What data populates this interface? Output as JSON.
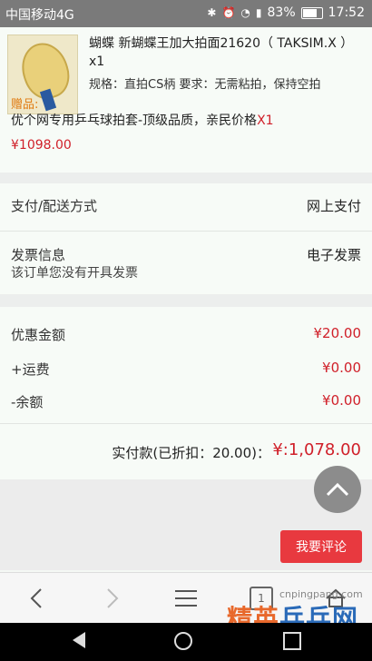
{
  "status_bar": {
    "carrier": "中国移动4G",
    "battery": "83%",
    "time": "17:52",
    "battery_level": 0.83
  },
  "product": {
    "title": "蝴蝶 新蝴蝶王加大拍面21620（ TAKSIM.X ） x1",
    "spec": "规格：直拍CS柄 要求：无需粘拍，保持空拍",
    "gift_label": "赠品:",
    "gift_text": "优个网专用乒乓球拍套-顶级品质，亲民价格",
    "gift_qty": "X1",
    "price": "¥1098.00"
  },
  "payment": {
    "label": "支付/配送方式",
    "value": "网上支付"
  },
  "invoice": {
    "label": "发票信息",
    "sub": "该订单您没有开具发票",
    "value": "电子发票"
  },
  "summary": {
    "discount_label": "优惠金额",
    "discount_value": "¥20.00",
    "shipping_label": "+运费",
    "shipping_value": "¥0.00",
    "balance_label": "-余额",
    "balance_value": "¥0.00",
    "total_label": "实付款(已折扣：20.00)：",
    "total_value": "¥:1,078.00"
  },
  "actions": {
    "review": "我要评论"
  },
  "browser_bar": {
    "tab_count": "1"
  },
  "watermark": {
    "url": "cnpingpang.com",
    "text_a": "精英",
    "text_b": "乒乓网"
  },
  "colors": {
    "accent": "#e8393f",
    "price": "#d0202a",
    "gift": "#e07a10"
  }
}
